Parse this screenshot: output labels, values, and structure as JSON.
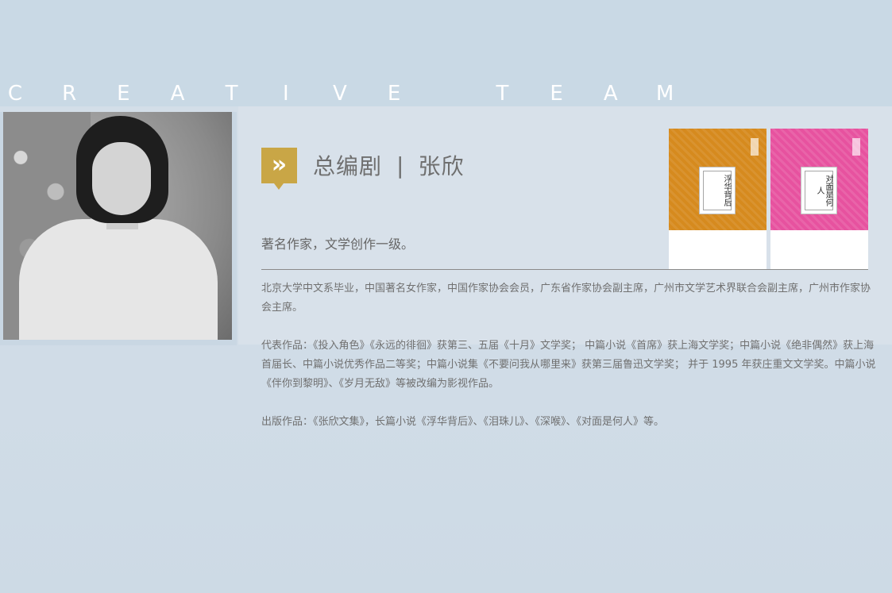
{
  "heading": {
    "letters": [
      "C",
      "R",
      "E",
      "A",
      "T",
      "I",
      "V",
      "E",
      " ",
      "T",
      "E",
      "A",
      "M"
    ]
  },
  "title": {
    "icon": "double-chevron-right-icon",
    "icon_glyph": "»",
    "role": "总编剧",
    "divider": "|",
    "name": "张欣"
  },
  "subtitle": "著名作家，文学创作一级。",
  "bio": "北京大学中文系毕业，中国著名女作家，中国作家协会会员，广东省作家协会副主席，广州市文学艺术界联合会副主席，广州市作家协会主席。",
  "representative": "代表作品：《投入角色》《永远的徘徊》获第三、五届《十月》文学奖； 中篇小说《首席》获上海文学奖；中篇小说《绝非偶然》获上海首届长、中篇小说优秀作品二等奖；中篇小说集《不要问我从哪里来》获第三届鲁迅文学奖； 并于 1995 年获庄重文文学奖。中篇小说《伴你到黎明》、《岁月无敌》等被改编为影视作品。",
  "publications": "出版作品：《张欣文集》，长篇小说《浮华背后》、《泪珠儿》、《深喉》、《对面是何人》等。",
  "books": [
    {
      "title": "浮华背后",
      "color": "#d68a1e"
    },
    {
      "title": "对面是何人",
      "color": "#e7529f"
    }
  ],
  "colors": {
    "accent": "#c9a646",
    "text": "#707070"
  }
}
